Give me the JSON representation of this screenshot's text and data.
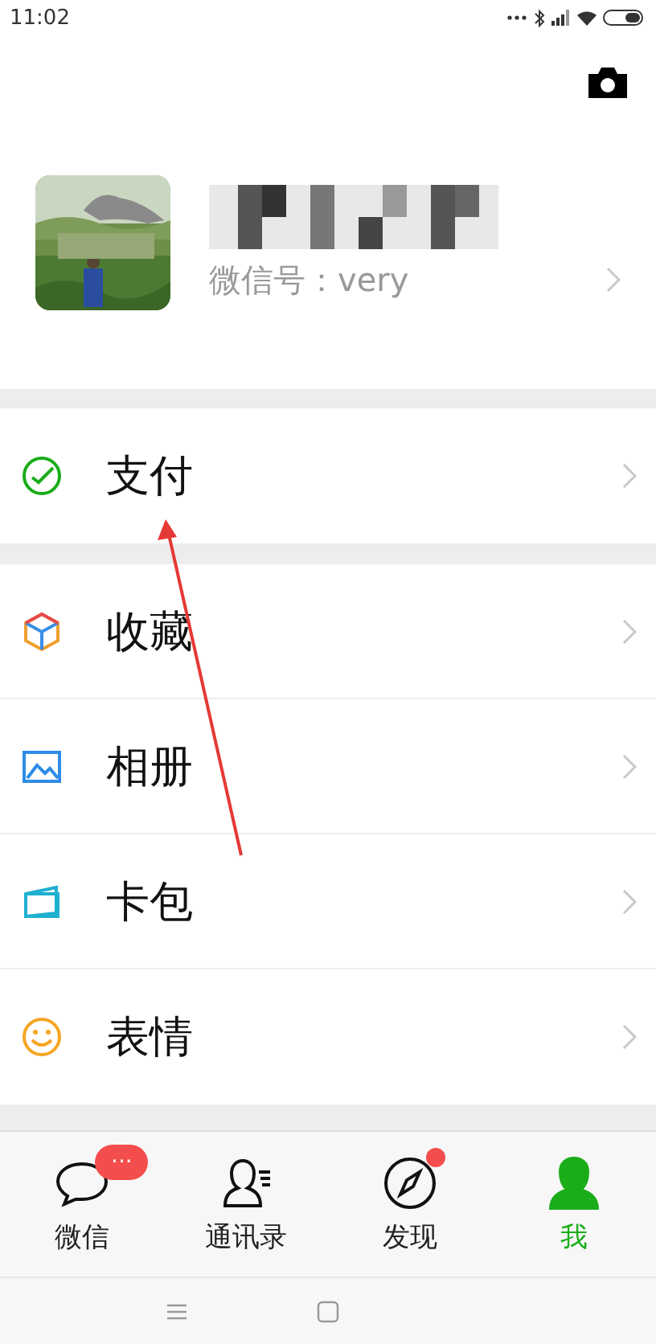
{
  "status_bar": {
    "time": "11:02"
  },
  "profile": {
    "wechat_id": "微信号：very"
  },
  "menu_groups": [
    [
      {
        "kind": "pay",
        "label": "支付"
      }
    ],
    [
      {
        "kind": "favorites",
        "label": "收藏"
      },
      {
        "kind": "album",
        "label": "相册"
      },
      {
        "kind": "cards",
        "label": "卡包"
      },
      {
        "kind": "stickers",
        "label": "表情"
      }
    ]
  ],
  "annotation": {
    "kind": "arrow"
  },
  "tabs": [
    {
      "kind": "chat",
      "label": "微信",
      "selected": false,
      "badge": "···",
      "dot": false
    },
    {
      "kind": "contacts",
      "label": "通讯录",
      "selected": false,
      "dot": false
    },
    {
      "kind": "discover",
      "label": "发现",
      "selected": false,
      "dot": true
    },
    {
      "kind": "me",
      "label": "我",
      "selected": true,
      "dot": false
    }
  ]
}
